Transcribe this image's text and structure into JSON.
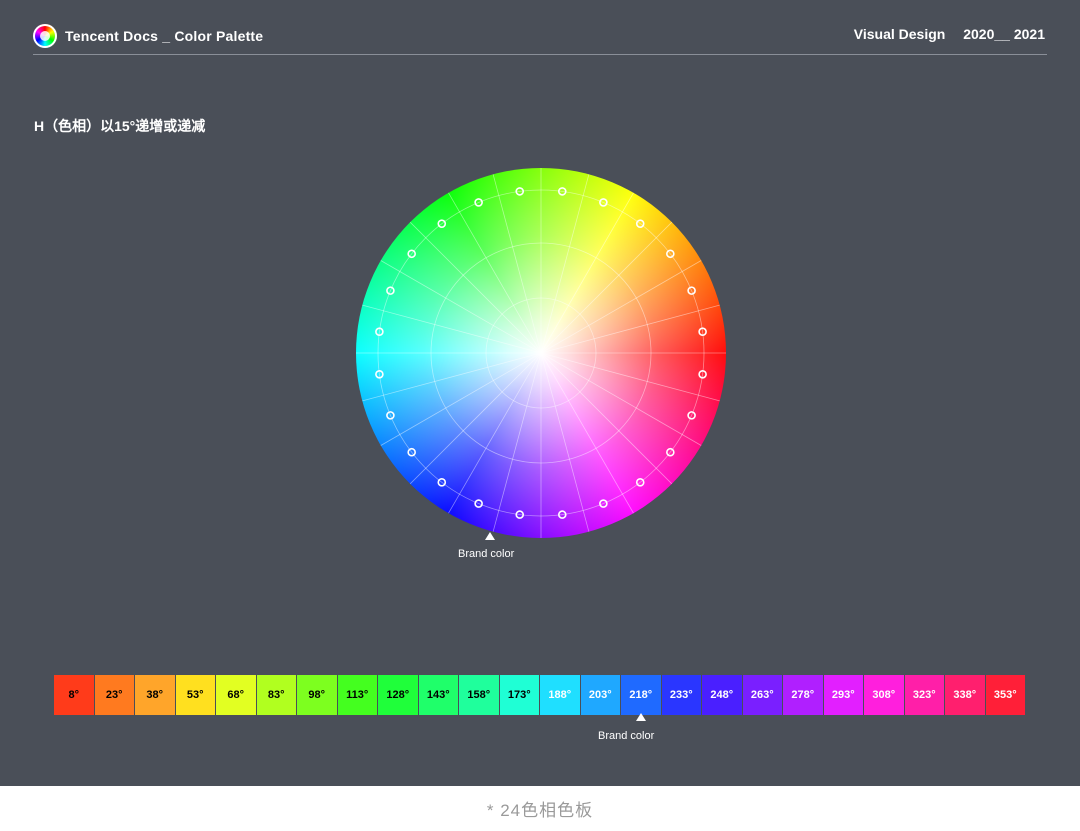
{
  "header": {
    "logo_icon": "color-wheel-logo-icon",
    "title": "Tencent Docs _ Color Palette",
    "subtitle": "Visual Design",
    "years": "2020__ 2021"
  },
  "section": {
    "title": "H（色相）以15°递增或递减"
  },
  "wheel": {
    "brand_label": "Brand color",
    "marker_count": 24,
    "brand_hue_deg": 218
  },
  "palette": {
    "brand_label": "Brand color",
    "swatches": [
      {
        "label": "8°",
        "color": "#ff3b1a",
        "text": "#000000"
      },
      {
        "label": "23°",
        "color": "#ff7a1f",
        "text": "#000000"
      },
      {
        "label": "38°",
        "color": "#ffa52a",
        "text": "#000000"
      },
      {
        "label": "53°",
        "color": "#ffe01f",
        "text": "#000000"
      },
      {
        "label": "68°",
        "color": "#e2ff22",
        "text": "#000000"
      },
      {
        "label": "83°",
        "color": "#b1ff1f",
        "text": "#000000"
      },
      {
        "label": "98°",
        "color": "#7dff1f",
        "text": "#000000"
      },
      {
        "label": "113°",
        "color": "#44ff1f",
        "text": "#000000"
      },
      {
        "label": "128°",
        "color": "#1fff3a",
        "text": "#000000"
      },
      {
        "label": "143°",
        "color": "#1fff6a",
        "text": "#000000"
      },
      {
        "label": "158°",
        "color": "#1fff9c",
        "text": "#000000"
      },
      {
        "label": "173°",
        "color": "#1fffd5",
        "text": "#000000"
      },
      {
        "label": "188°",
        "color": "#1fdfff",
        "text": "#ffffff"
      },
      {
        "label": "203°",
        "color": "#1fa8ff",
        "text": "#ffffff"
      },
      {
        "label": "218°",
        "color": "#1f6aff",
        "text": "#ffffff"
      },
      {
        "label": "233°",
        "color": "#2a36ff",
        "text": "#ffffff"
      },
      {
        "label": "248°",
        "color": "#4a1fff",
        "text": "#ffffff"
      },
      {
        "label": "263°",
        "color": "#7a1fff",
        "text": "#ffffff"
      },
      {
        "label": "278°",
        "color": "#b01fff",
        "text": "#ffffff"
      },
      {
        "label": "293°",
        "color": "#e21fff",
        "text": "#ffffff"
      },
      {
        "label": "308°",
        "color": "#ff1fdd",
        "text": "#ffffff"
      },
      {
        "label": "323°",
        "color": "#ff1fa8",
        "text": "#ffffff"
      },
      {
        "label": "338°",
        "color": "#ff1f6e",
        "text": "#ffffff"
      },
      {
        "label": "353°",
        "color": "#ff1f38",
        "text": "#ffffff"
      }
    ]
  },
  "footer": {
    "caption": "* 24色相色板"
  }
}
